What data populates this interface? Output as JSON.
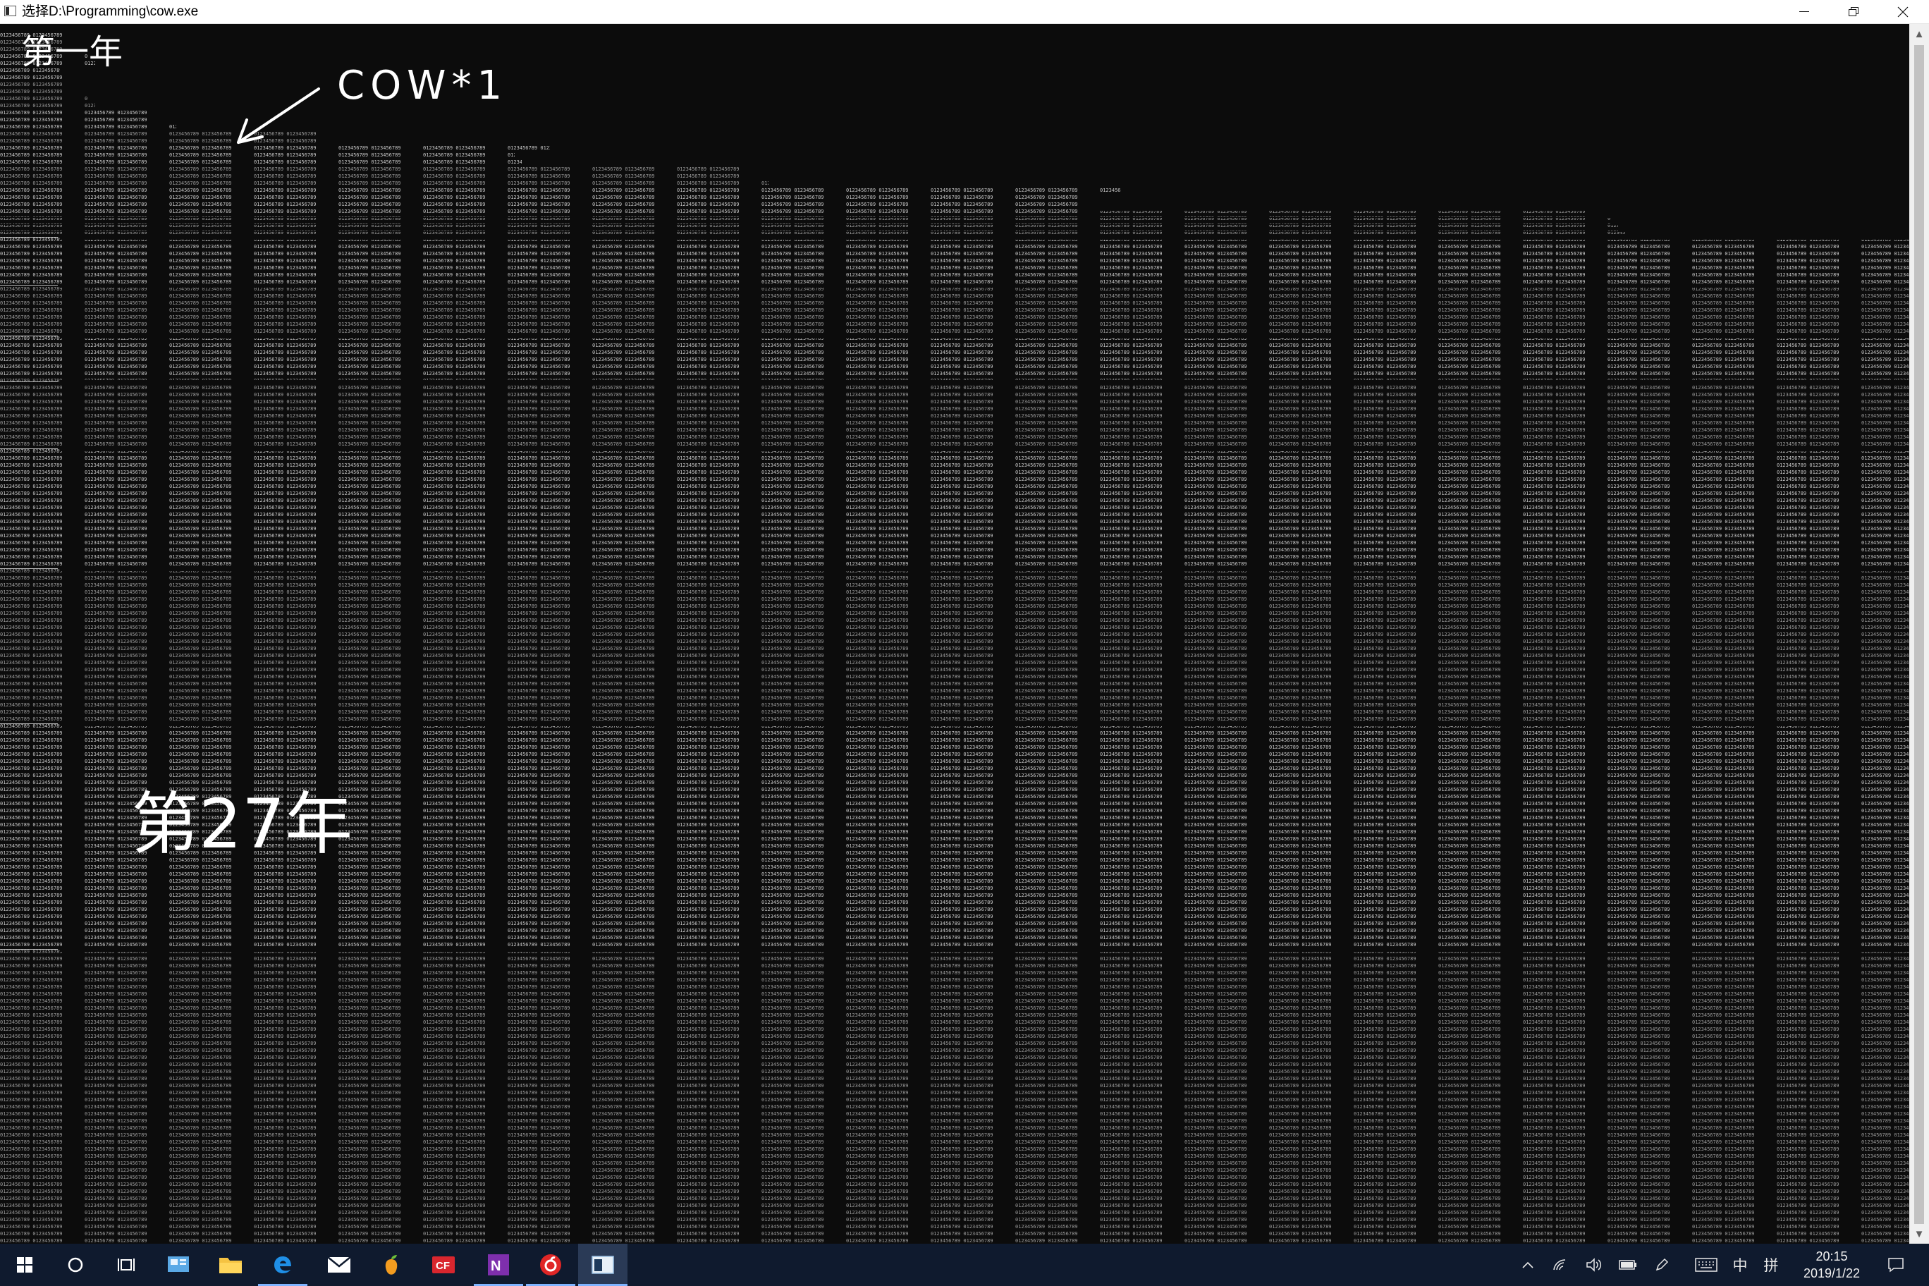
{
  "window": {
    "title": "选择D:\\Programming\\cow.exe",
    "controls": {
      "minimize": "minimize",
      "restore": "restore",
      "close": "close"
    }
  },
  "annotations": {
    "year_one": "第一年",
    "cow_label": "COW*1",
    "year_27": "第27年"
  },
  "console_output": {
    "sample_digits": "0123456789"
  },
  "taskbar": {
    "apps": [
      {
        "name": "start",
        "icon": "windows-start-icon"
      },
      {
        "name": "search",
        "icon": "cortana-circle-icon"
      },
      {
        "name": "task-view",
        "icon": "task-view-icon"
      },
      {
        "name": "app-1",
        "icon": "control-panel-icon"
      },
      {
        "name": "file-explorer",
        "icon": "folder-icon"
      },
      {
        "name": "edge",
        "icon": "edge-browser-icon"
      },
      {
        "name": "mail",
        "icon": "mail-icon"
      },
      {
        "name": "fl-studio",
        "icon": "fruit-icon"
      },
      {
        "name": "app-red",
        "icon": "red-app-icon"
      },
      {
        "name": "onenote",
        "icon": "onenote-icon"
      },
      {
        "name": "netease-music",
        "icon": "netease-music-icon"
      },
      {
        "name": "console",
        "icon": "console-window-icon"
      }
    ],
    "tray": {
      "ime_language": "中",
      "ime_mode": "拼",
      "time": "20:15",
      "date": "2019/1/22"
    }
  }
}
